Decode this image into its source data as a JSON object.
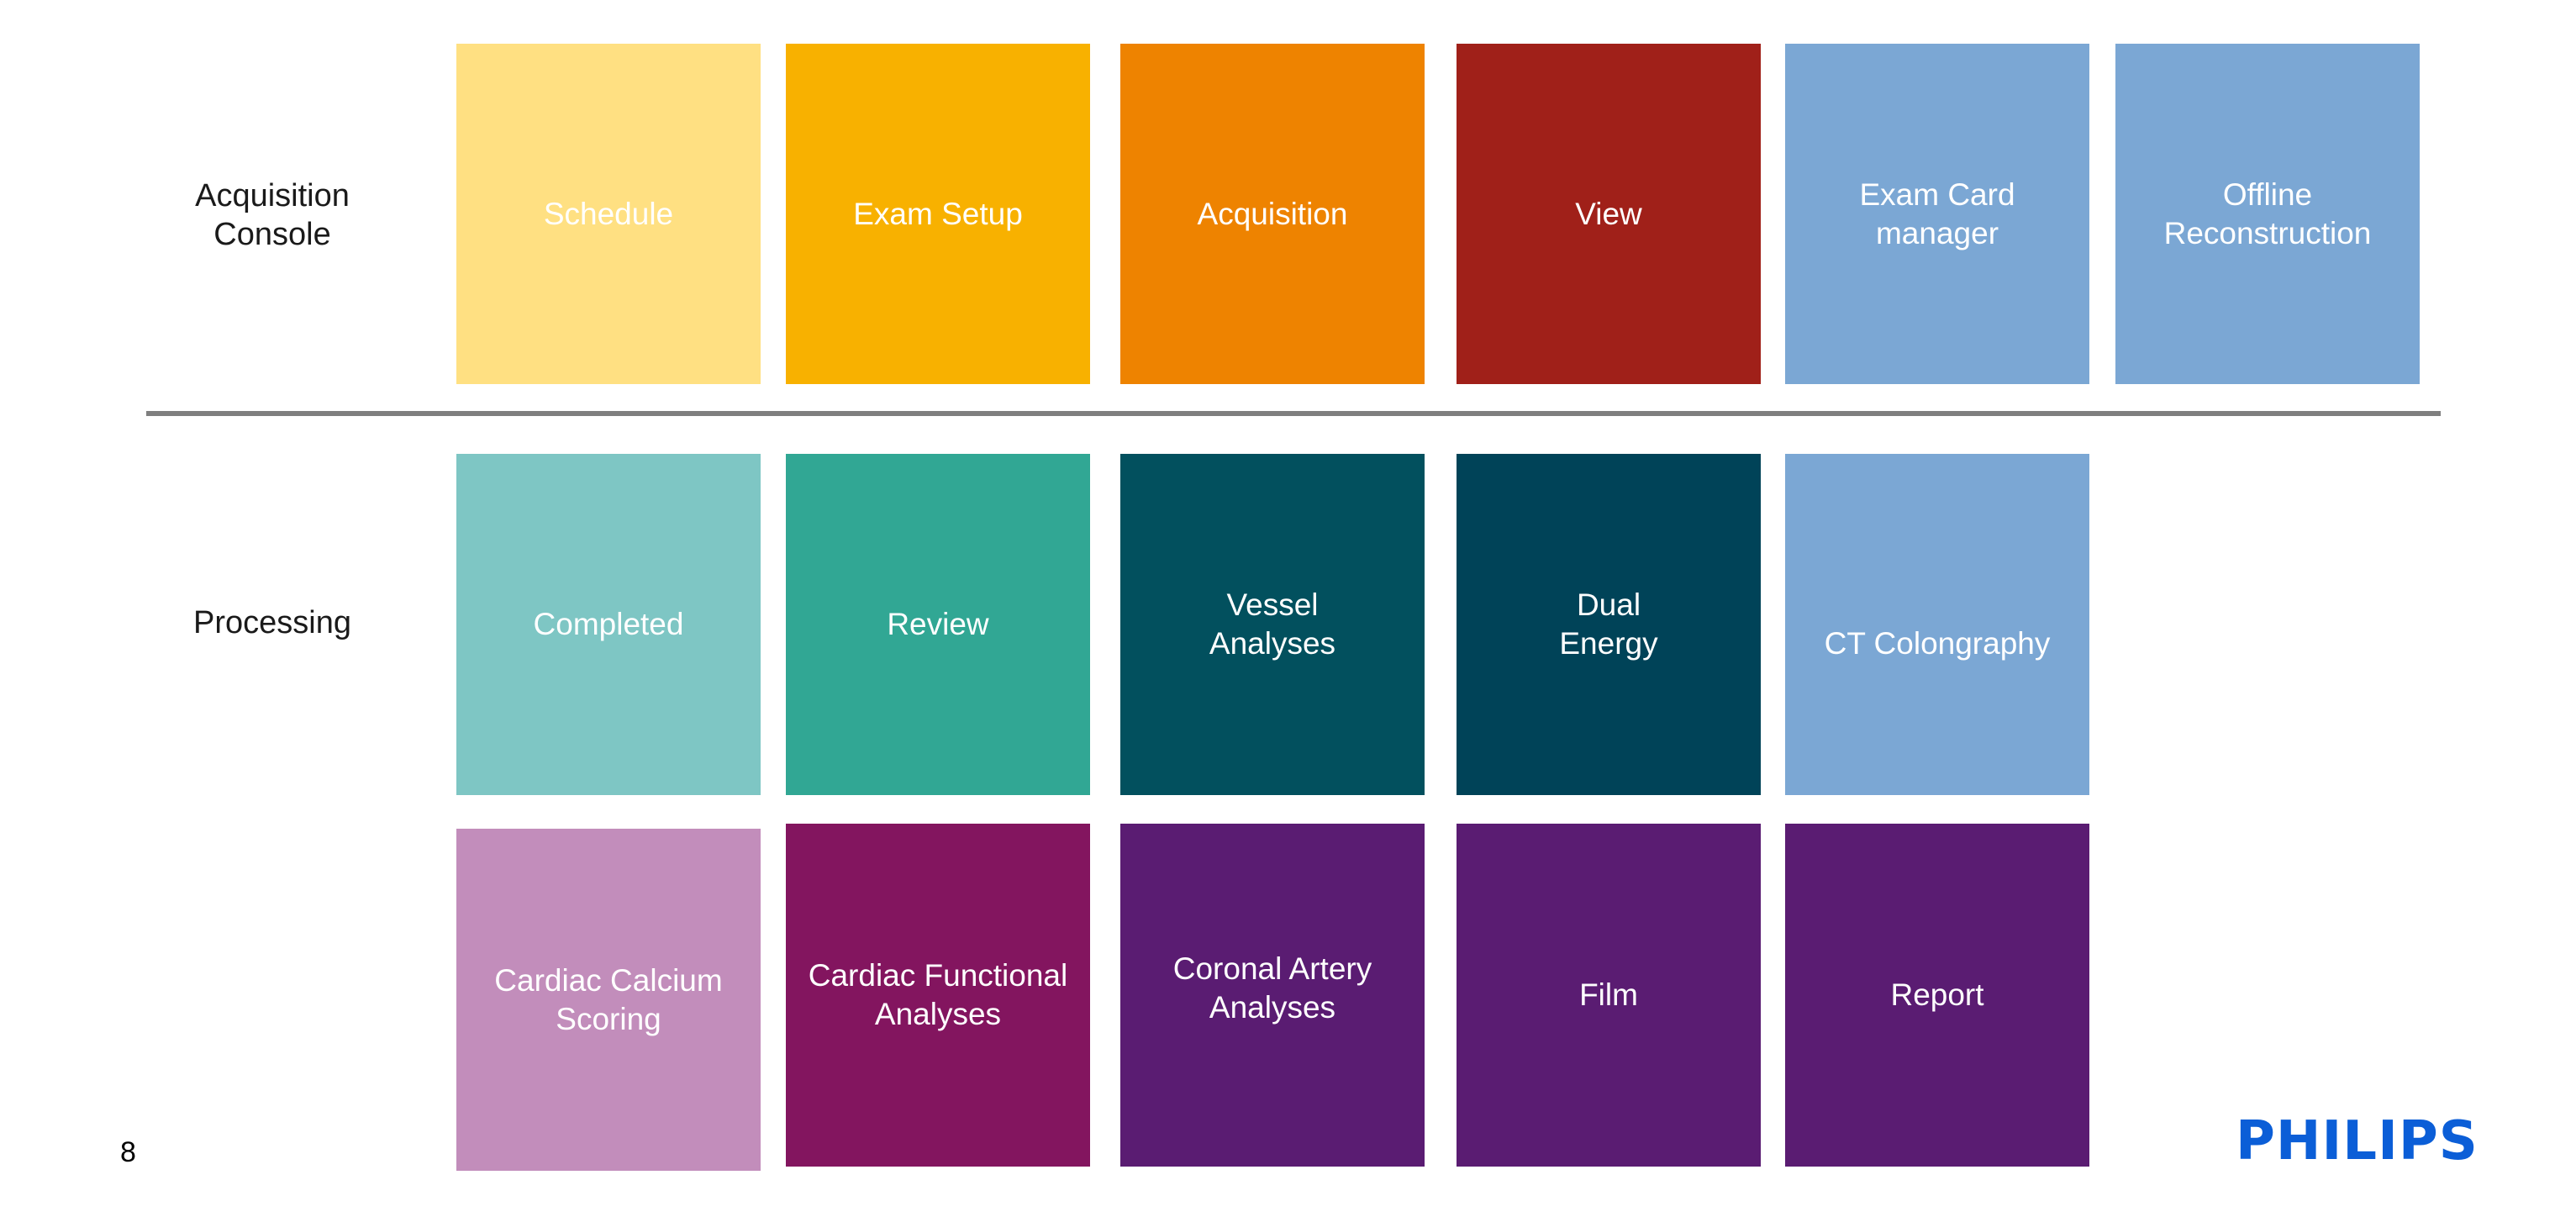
{
  "rows": {
    "acquisition": {
      "label": "Acquisition\nConsole"
    },
    "processing": {
      "label": "Processing"
    }
  },
  "tiles": {
    "schedule": {
      "label": "Schedule",
      "color": "#FFE082"
    },
    "exam_setup": {
      "label": "Exam Setup",
      "color": "#F8B100"
    },
    "acquisition": {
      "label": "Acquisition",
      "color": "#EE8300"
    },
    "view": {
      "label": "View",
      "color": "#A02019"
    },
    "exam_card_manager": {
      "label": "Exam Card\nmanager",
      "color": "#7BA7D4"
    },
    "offline_reconstruction": {
      "label": "Offline\nReconstruction",
      "color": "#7BA7D4"
    },
    "completed": {
      "label": "Completed",
      "color": "#7EC6C4"
    },
    "review": {
      "label": "Review",
      "color": "#31A794"
    },
    "vessel_analyses": {
      "label": "Vessel\nAnalyses",
      "color": "#02505E"
    },
    "dual_energy": {
      "label": "Dual\nEnergy",
      "color": "#004358"
    },
    "ct_colongraphy": {
      "label": "CT Colongraphy",
      "color": "#7BA7D4"
    },
    "cardiac_calcium_scoring": {
      "label": "Cardiac Calcium\nScoring",
      "color": "#C28DBB"
    },
    "cardiac_functional_analyses": {
      "label": "Cardiac Functional\nAnalyses",
      "color": "#83155F"
    },
    "coronal_artery_analyses": {
      "label": "Coronal Artery\nAnalyses",
      "color": "#5A1C72"
    },
    "film": {
      "label": "Film",
      "color": "#5A1C72"
    },
    "report": {
      "label": "Report",
      "color": "#5A1C72"
    }
  },
  "footer": {
    "page_number": "8",
    "logo_text": "PHILIPS",
    "logo_color": "#0B5ED7"
  }
}
